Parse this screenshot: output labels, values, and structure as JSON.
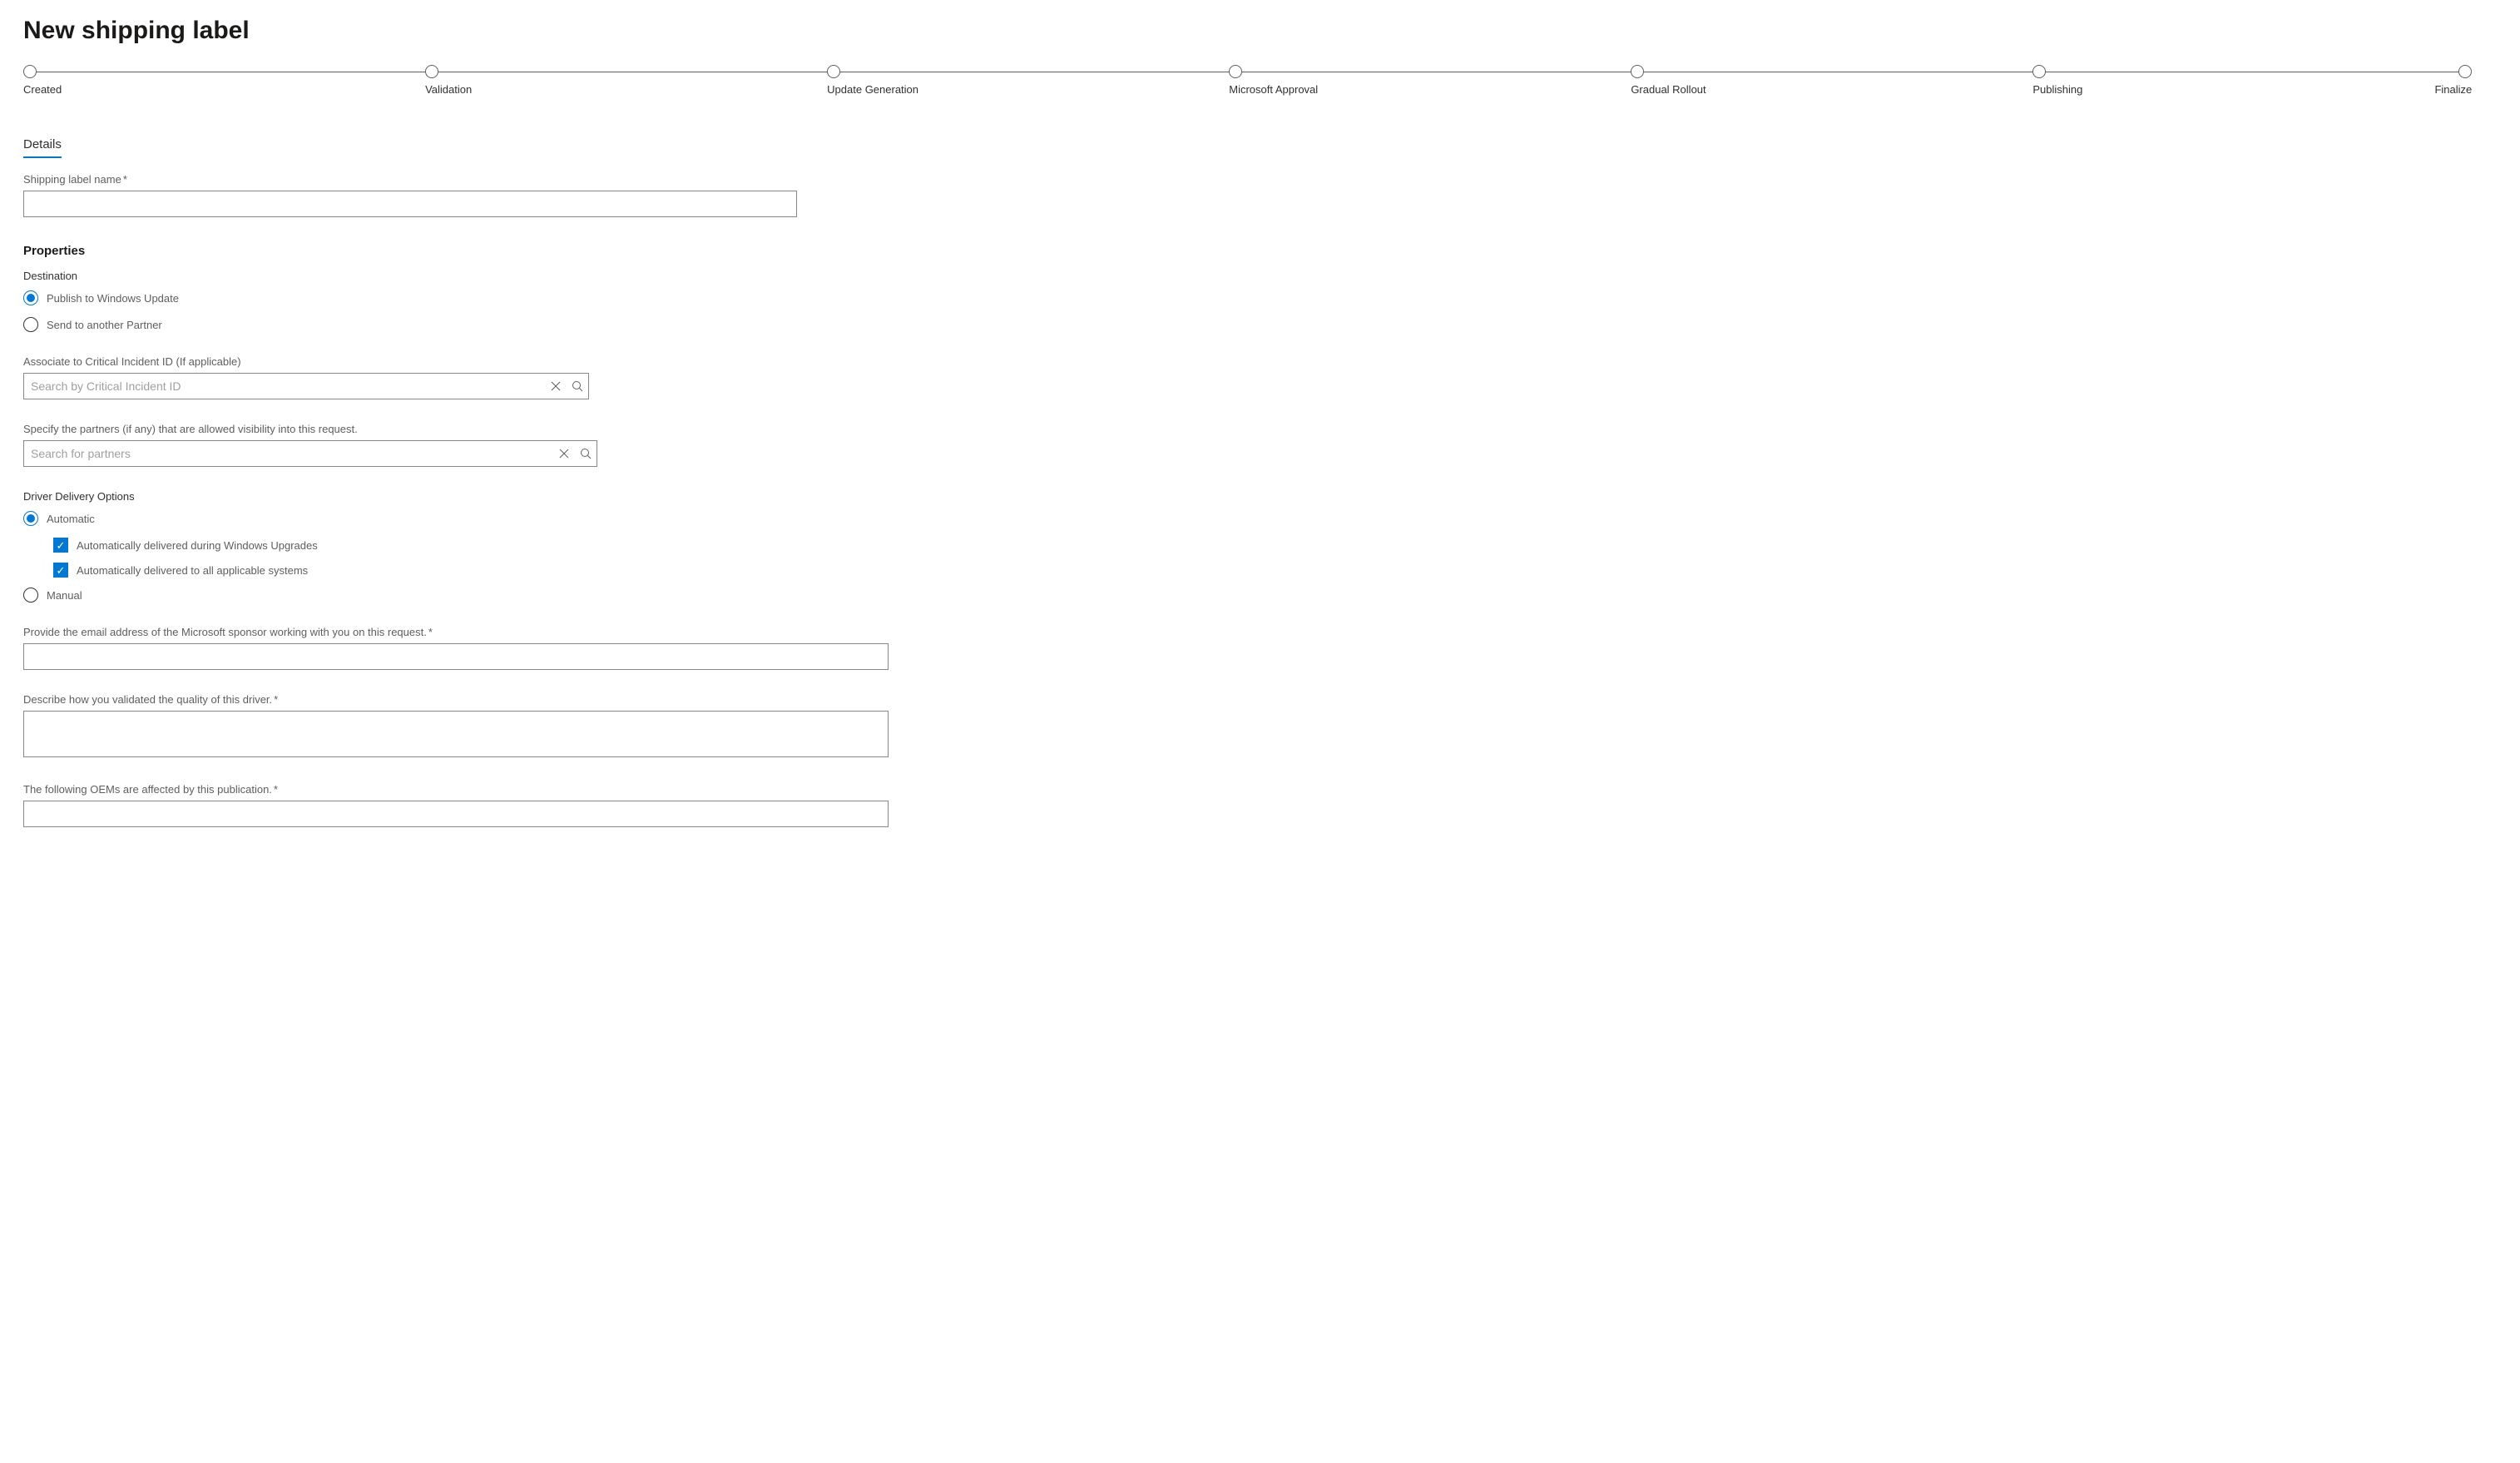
{
  "header": {
    "title": "New shipping label"
  },
  "stepper": {
    "steps": [
      "Created",
      "Validation",
      "Update Generation",
      "Microsoft Approval",
      "Gradual Rollout",
      "Publishing",
      "Finalize"
    ]
  },
  "tabs": {
    "details": "Details"
  },
  "details": {
    "name_label": "Shipping label name",
    "name_value": ""
  },
  "properties": {
    "heading": "Properties",
    "destination_label": "Destination",
    "destination_options": {
      "publish_wu": "Publish to Windows Update",
      "send_partner": "Send to another Partner"
    },
    "critical_incident": {
      "label": "Associate to Critical Incident ID (If applicable)",
      "placeholder": "Search by Critical Incident ID"
    },
    "partners": {
      "label": "Specify the partners (if any) that are allowed visibility into this request.",
      "placeholder": "Search for partners"
    },
    "delivery": {
      "label": "Driver Delivery Options",
      "automatic": "Automatic",
      "auto_upgrades": "Automatically delivered during Windows Upgrades",
      "auto_systems": "Automatically delivered to all applicable systems",
      "manual": "Manual"
    },
    "sponsor": {
      "label": "Provide the email address of the Microsoft sponsor working with you on this request.",
      "value": ""
    },
    "validation_desc": {
      "label": "Describe how you validated the quality of this driver.",
      "value": ""
    },
    "oems": {
      "label": "The following OEMs are affected by this publication.",
      "value": ""
    }
  }
}
